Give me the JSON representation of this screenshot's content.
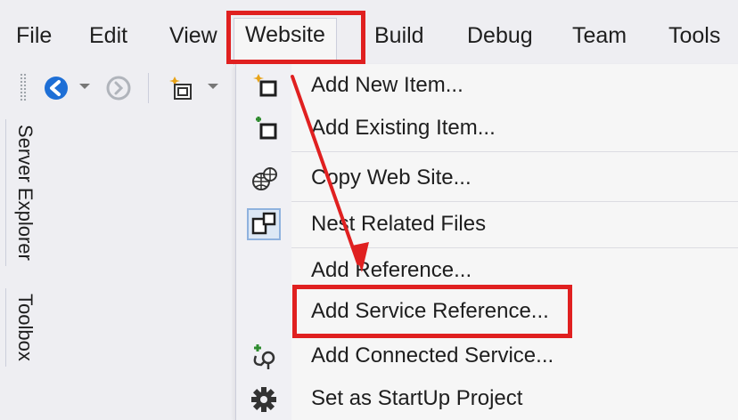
{
  "menubar": {
    "items": [
      "File",
      "Edit",
      "View",
      "Website",
      "Build",
      "Debug",
      "Team",
      "Tools"
    ],
    "open_item": "Website"
  },
  "toolbar": {
    "icons": [
      "back-icon",
      "dropdown-arrow-icon",
      "forward-icon",
      "new-item-icon",
      "dropdown-arrow-icon"
    ]
  },
  "sidebar": {
    "tabs": [
      "Server Explorer",
      "Toolbox"
    ]
  },
  "website_menu": {
    "items": [
      {
        "label": "Add New Item...",
        "icon": "add-new-item-icon"
      },
      {
        "label": "Add Existing Item...",
        "icon": "add-existing-item-icon"
      },
      {
        "label": "Copy Web Site...",
        "icon": "copy-web-site-icon"
      },
      {
        "label": "Nest Related Files",
        "icon": "nest-related-files-icon"
      },
      {
        "label": "Add Reference...",
        "icon": ""
      },
      {
        "label": "Add Service Reference...",
        "icon": ""
      },
      {
        "label": "Add Connected Service...",
        "icon": "connected-service-icon"
      },
      {
        "label": "Set as StartUp Project",
        "icon": "gear-icon"
      }
    ]
  },
  "annotations": {
    "highlight_color": "#e02020",
    "accent_blue": "#1e6fd6"
  }
}
